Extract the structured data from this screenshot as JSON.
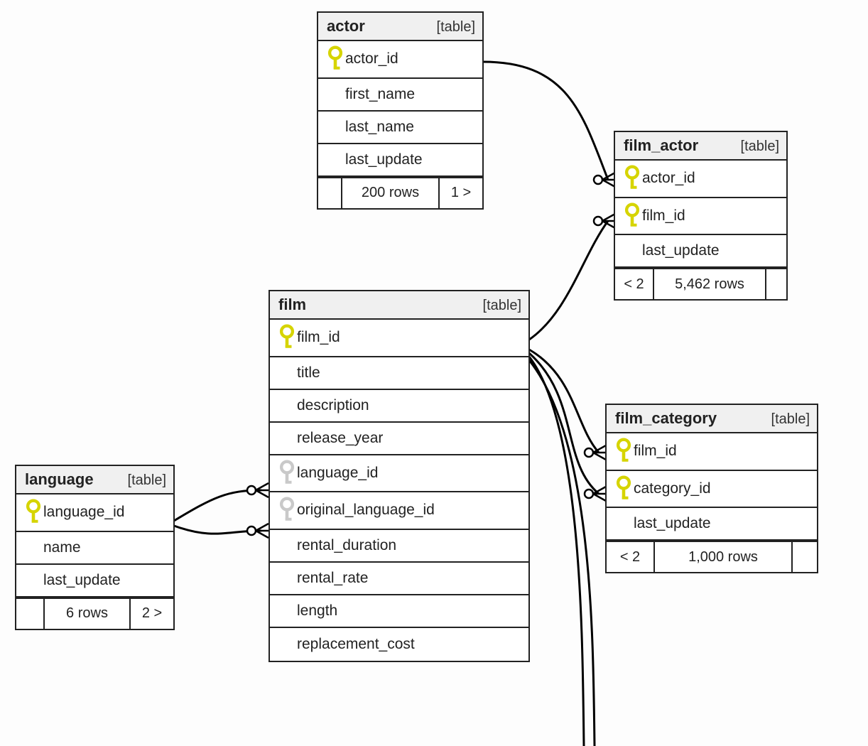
{
  "type_label": "[table]",
  "entities": {
    "actor": {
      "name": "actor",
      "columns": [
        {
          "name": "actor_id",
          "key": "pk"
        },
        {
          "name": "first_name",
          "key": null
        },
        {
          "name": "last_name",
          "key": null
        },
        {
          "name": "last_update",
          "key": null
        }
      ],
      "footer": {
        "left": "",
        "rows": "200 rows",
        "right": "1 >"
      }
    },
    "film_actor": {
      "name": "film_actor",
      "columns": [
        {
          "name": "actor_id",
          "key": "pk"
        },
        {
          "name": "film_id",
          "key": "pk"
        },
        {
          "name": "last_update",
          "key": null
        }
      ],
      "footer": {
        "left": "< 2",
        "rows": "5,462 rows",
        "right": ""
      }
    },
    "film": {
      "name": "film",
      "columns": [
        {
          "name": "film_id",
          "key": "pk"
        },
        {
          "name": "title",
          "key": null
        },
        {
          "name": "description",
          "key": null
        },
        {
          "name": "release_year",
          "key": null
        },
        {
          "name": "language_id",
          "key": "fk"
        },
        {
          "name": "original_language_id",
          "key": "fk"
        },
        {
          "name": "rental_duration",
          "key": null
        },
        {
          "name": "rental_rate",
          "key": null
        },
        {
          "name": "length",
          "key": null
        },
        {
          "name": "replacement_cost",
          "key": null
        }
      ]
    },
    "film_category": {
      "name": "film_category",
      "columns": [
        {
          "name": "film_id",
          "key": "pk"
        },
        {
          "name": "category_id",
          "key": "pk"
        },
        {
          "name": "last_update",
          "key": null
        }
      ],
      "footer": {
        "left": "< 2",
        "rows": "1,000 rows",
        "right": ""
      }
    },
    "language": {
      "name": "language",
      "columns": [
        {
          "name": "language_id",
          "key": "pk"
        },
        {
          "name": "name",
          "key": null
        },
        {
          "name": "last_update",
          "key": null
        }
      ],
      "footer": {
        "left": "",
        "rows": "6 rows",
        "right": "2 >"
      }
    }
  },
  "relationships": [
    {
      "from": "actor.actor_id",
      "to": "film_actor.actor_id"
    },
    {
      "from": "film.film_id",
      "to": "film_actor.film_id"
    },
    {
      "from": "film.film_id",
      "to": "film_category.film_id"
    },
    {
      "from": "language.language_id",
      "to": "film.language_id"
    },
    {
      "from": "language.language_id",
      "to": "film.original_language_id"
    }
  ]
}
